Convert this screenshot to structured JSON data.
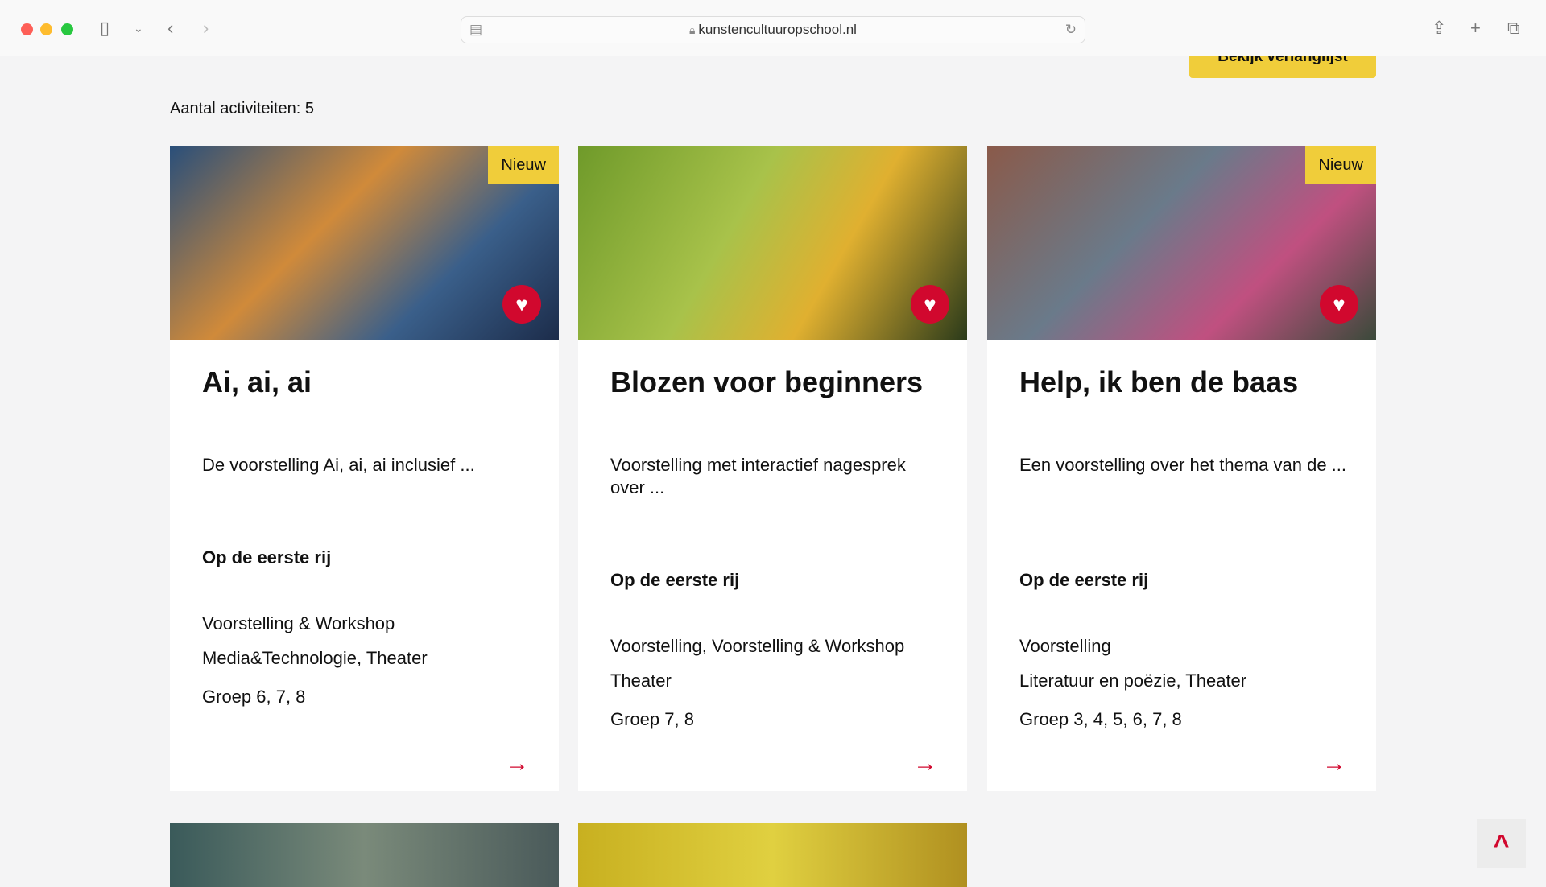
{
  "browser": {
    "url": "kunstencultuuropschool.nl"
  },
  "header": {
    "wishlist_button": "Bekijk verlanglijst"
  },
  "results": {
    "count_label": "Aantal activiteiten: 5"
  },
  "cards": [
    {
      "title": "Ai, ai, ai",
      "badge": "Nieuw",
      "description": "De voorstelling Ai, ai, ai inclusief ...",
      "provider": "Op de eerste rij",
      "types": "Voorstelling & Workshop",
      "disciplines": "Media&Technologie, Theater",
      "groups": "Groep 6, 7, 8"
    },
    {
      "title": "Blozen voor beginners",
      "description": "Voorstelling met interactief nagesprek over ...",
      "provider": "Op de eerste rij",
      "types": "Voorstelling, Voorstelling & Workshop",
      "disciplines": "Theater",
      "groups": "Groep 7, 8"
    },
    {
      "title": "Help, ik ben de baas",
      "badge": "Nieuw",
      "description": "Een voorstelling over het thema van de ...",
      "provider": "Op de eerste rij",
      "types": "Voorstelling",
      "disciplines": "Literatuur en poëzie, Theater",
      "groups": "Groep 3, 4, 5, 6, 7, 8"
    }
  ],
  "colors": {
    "accent": "#d1082e",
    "badge": "#f0cd3a"
  }
}
